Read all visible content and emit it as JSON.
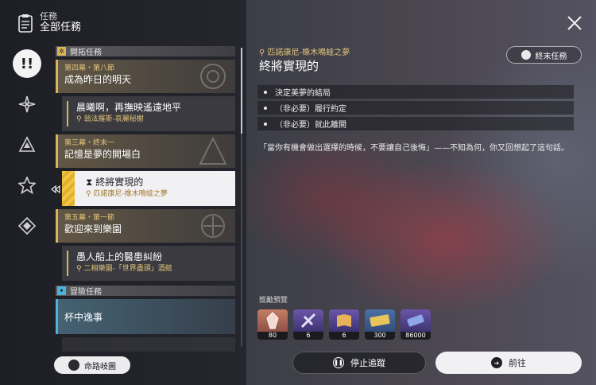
{
  "header": {
    "category": "任務",
    "title": "全部任務"
  },
  "rail": [
    {
      "icon": "exclamation-icon",
      "active": true
    },
    {
      "icon": "diamond-star-icon"
    },
    {
      "icon": "triangle-icon"
    },
    {
      "icon": "star-icon"
    },
    {
      "icon": "diamond-icon"
    }
  ],
  "list": {
    "trailblaze_header": "開拓任務",
    "adventure_header": "冒險任務",
    "chapters": [
      {
        "act": "第四幕・第八節",
        "name": "成為昨日的明天"
      },
      {
        "act": "第三幕・終末一",
        "name": "記憶是夢的開場白"
      },
      {
        "act": "第五幕・第一節",
        "name": "歡迎來到樂園"
      }
    ],
    "quests": [
      {
        "name": "晨曦啊，再撫映遙遠地平",
        "location": "翁法羅斯-哀麗秘榭"
      },
      {
        "name": "終將實現的",
        "location": "匹諾康尼-橡木鳴蛙之夢"
      },
      {
        "name": "愚人船上的醫患糾紛",
        "location": "二相樂園-「世界盡頭」酒館"
      }
    ],
    "side_quest": "杯中逸事"
  },
  "pill_button": "命路岐圖",
  "detail": {
    "location": "匹諾康尼-橡木鳴蛙之夢",
    "title": "終將實現的",
    "end_button": "終末任務",
    "objectives": [
      "決定美夢的結局",
      "（非必要）履行約定",
      "（非必要）就此離開"
    ],
    "description": "「當你有機會做出選擇的時候，不要讓自己後悔」——不知為何，你又回想起了這句話。",
    "rewards_label": "獎勵預覽",
    "rewards": [
      {
        "count": "80"
      },
      {
        "count": "6"
      },
      {
        "count": "6"
      },
      {
        "count": "300"
      },
      {
        "count": "86000"
      }
    ]
  },
  "buttons": {
    "stop": "停止追蹤",
    "go": "前往"
  },
  "colors": {
    "accent_gold": "#d9b45a",
    "accent_blue": "#4fb3d9",
    "selected_bg": "#f1f1f3"
  }
}
